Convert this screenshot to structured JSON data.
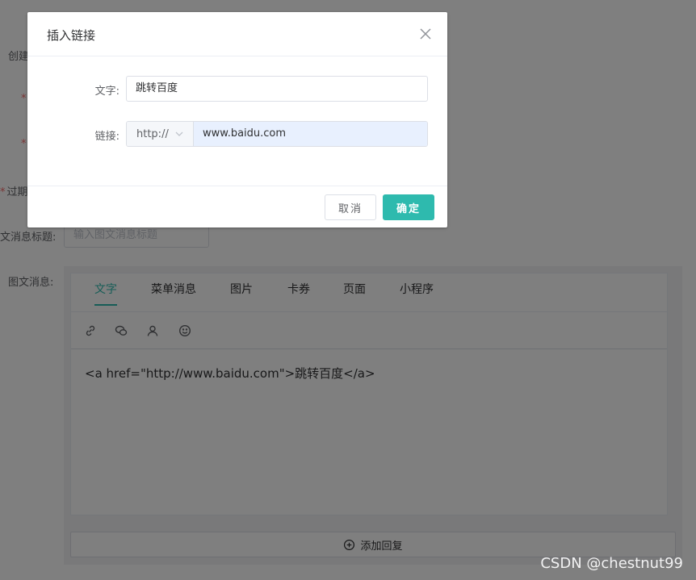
{
  "background_form": {
    "label_create": "创建",
    "label_expire": "过期",
    "label_title": "文消息标题:",
    "title_placeholder": "输入图文消息标题",
    "label_message": "图文消息:",
    "required_mark": "*"
  },
  "tabs": [
    {
      "label": "文字",
      "active": true
    },
    {
      "label": "菜单消息",
      "active": false
    },
    {
      "label": "图片",
      "active": false
    },
    {
      "label": "卡券",
      "active": false
    },
    {
      "label": "页面",
      "active": false
    },
    {
      "label": "小程序",
      "active": false
    }
  ],
  "toolbar": {
    "icons": [
      "link-icon",
      "wechat-icon",
      "user-icon",
      "emoji-icon"
    ]
  },
  "editor": {
    "content": "<a href=\"http://www.baidu.com\">跳转百度</a>"
  },
  "add_reply": {
    "label": "添加回复",
    "icon": "plus-circle-icon"
  },
  "dialog": {
    "title": "插入链接",
    "text_label": "文字:",
    "text_value": "跳转百度",
    "link_label": "链接:",
    "protocol": "http://",
    "url_value": "www.baidu.com",
    "cancel_label": "取消",
    "ok_label": "确定"
  },
  "watermark": "CSDN @chestnut99",
  "colors": {
    "accent": "#2ebaae",
    "required": "#f56c6c",
    "autofill": "#e8f0fe"
  }
}
